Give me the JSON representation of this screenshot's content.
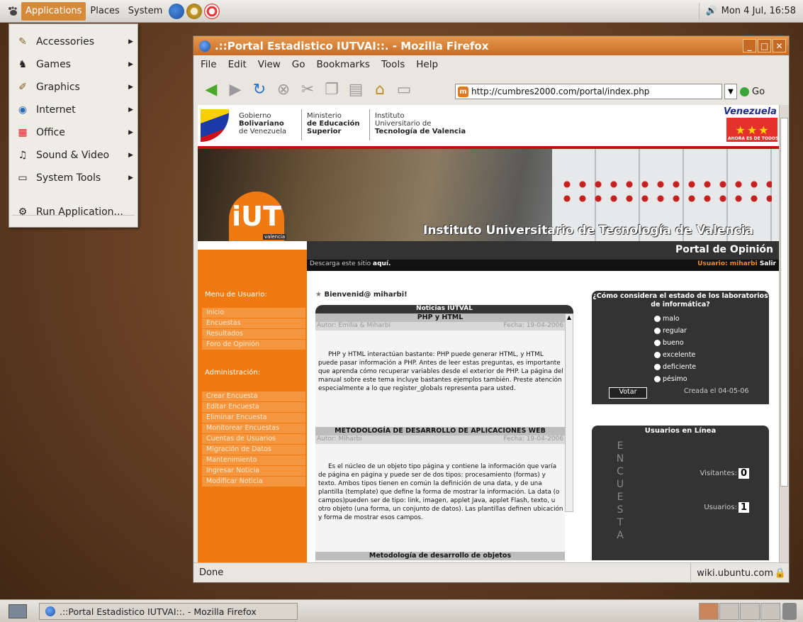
{
  "top_panel": {
    "menus": [
      "Applications",
      "Places",
      "System"
    ],
    "clock": "Mon  4 Jul, 16:58"
  },
  "app_menu": {
    "items": [
      {
        "label": "Accessories",
        "icon": "accessories-icon",
        "submenu": true
      },
      {
        "label": "Games",
        "icon": "games-icon",
        "submenu": true
      },
      {
        "label": "Graphics",
        "icon": "graphics-icon",
        "submenu": true
      },
      {
        "label": "Internet",
        "icon": "internet-icon",
        "submenu": true
      },
      {
        "label": "Office",
        "icon": "office-icon",
        "submenu": true
      },
      {
        "label": "Sound & Video",
        "icon": "sound-video-icon",
        "submenu": true
      },
      {
        "label": "System Tools",
        "icon": "system-tools-icon",
        "submenu": true
      }
    ],
    "run_label": "Run Application..."
  },
  "browser": {
    "title": ".::Portal Estadistico IUTVAI::. - Mozilla Firefox",
    "menus": [
      "File",
      "Edit",
      "View",
      "Go",
      "Bookmarks",
      "Tools",
      "Help"
    ],
    "url": "http://cumbres2000.com/portal/index.php",
    "go_label": "Go",
    "status": "Done",
    "status_right": "wiki.ubuntu.com"
  },
  "page": {
    "gov": {
      "col1": [
        "Gobierno",
        "Bolivariano",
        "de Venezuela"
      ],
      "col2": [
        "Ministerio",
        "de Educación",
        "Superior"
      ],
      "col3": [
        "Instituto",
        "Universitario de",
        "Tecnología de Valencia"
      ],
      "venezuela": "Venezuela",
      "venezuela_sub": "AHORA ES DE TODOS"
    },
    "banner_title": "Instituto Universitario de Tecnología de Valencia",
    "logo_text": "iUT",
    "logo_sub": "valencia",
    "portal_title": "Portal de Opinión",
    "download_text": "Descarga este sitio",
    "download_link": "aquí.",
    "user_label": "Usuario:",
    "user_name": "miharbi",
    "logout": "Salir",
    "welcome": "Bienvenid@ miharbi!",
    "menu_usuario": "Menu de Usuario:",
    "user_links": [
      "Inicio",
      "Encuestas",
      "Resultados",
      "Foro de Opinión"
    ],
    "admin_head": "Administración:",
    "admin_links": [
      "Crear Encuesta",
      "Editar Encuesta",
      "Eliminar Encuesta",
      "Monitorear Encuestas",
      "Cuentas de Usuarios",
      "Migración de Datos",
      "Mantenimiento",
      "Ingresar Noticia",
      "Modificar Noticia"
    ],
    "news": {
      "header": "Noticias IUTVAL",
      "items": [
        {
          "title": "PHP y HTML",
          "author": "Autor: Emilia & Miharbi",
          "date": "Fecha: 19-04-2006",
          "text": "PHP y HTML interactúan bastante: PHP puede generar HTML, y HTML puede pasar información a PHP. Antes de leer estas preguntas, es importante que aprenda cómo recuperar variables desde el exterior de PHP. La página del manual sobre este tema incluye bastantes ejemplos también. Preste atención especialmente a lo que register_globals representa para usted."
        },
        {
          "title": "METODOLOGÍA DE DESARROLLO DE APLICACIONES WEB",
          "author": "Autor: Miharbi",
          "date": "Fecha: 19-04-2006",
          "text": "Es el núcleo de un objeto tipo página y contiene la información que varía de página en página y puede ser de dos tipos: procesamiento (formas) y texto. Ambos tipos tienen en común la definición de una data, y de una plantilla (template) que define la forma de mostrar la información. La data (o campos)pueden ser de tipo: link, imagen, applet Java, applet Flash, texto, u otro objeto (una forma, un conjunto de datos). Las plantillas definen ubicación y forma de mostrar esos campos."
        },
        {
          "title": "Metodología de desarrollo de objetos",
          "author": "",
          "date": "",
          "text": ""
        }
      ]
    },
    "poll": {
      "question": "¿Cómo considera el estado de los laboratorios de informática?",
      "options": [
        "malo",
        "regular",
        "bueno",
        "excelente",
        "deficiente",
        "pésimo"
      ],
      "vote_label": "Votar",
      "created": "Creada el 04-05-06"
    },
    "online": {
      "title": "Usuarios en Línea",
      "vertical": [
        "E",
        "N",
        "C",
        "U",
        "E",
        "S",
        "T",
        "A"
      ],
      "visitors_label": "Visitantes:",
      "visitors": "0",
      "users_label": "Usuarios:",
      "users": "1"
    }
  },
  "taskbar": {
    "task_label": ".::Portal Estadistico IUTVAI::. - Mozilla Firefox"
  },
  "colors": {
    "accent": "#f07a10",
    "title_bar": "#d77a33",
    "dark_panel": "#333333"
  }
}
